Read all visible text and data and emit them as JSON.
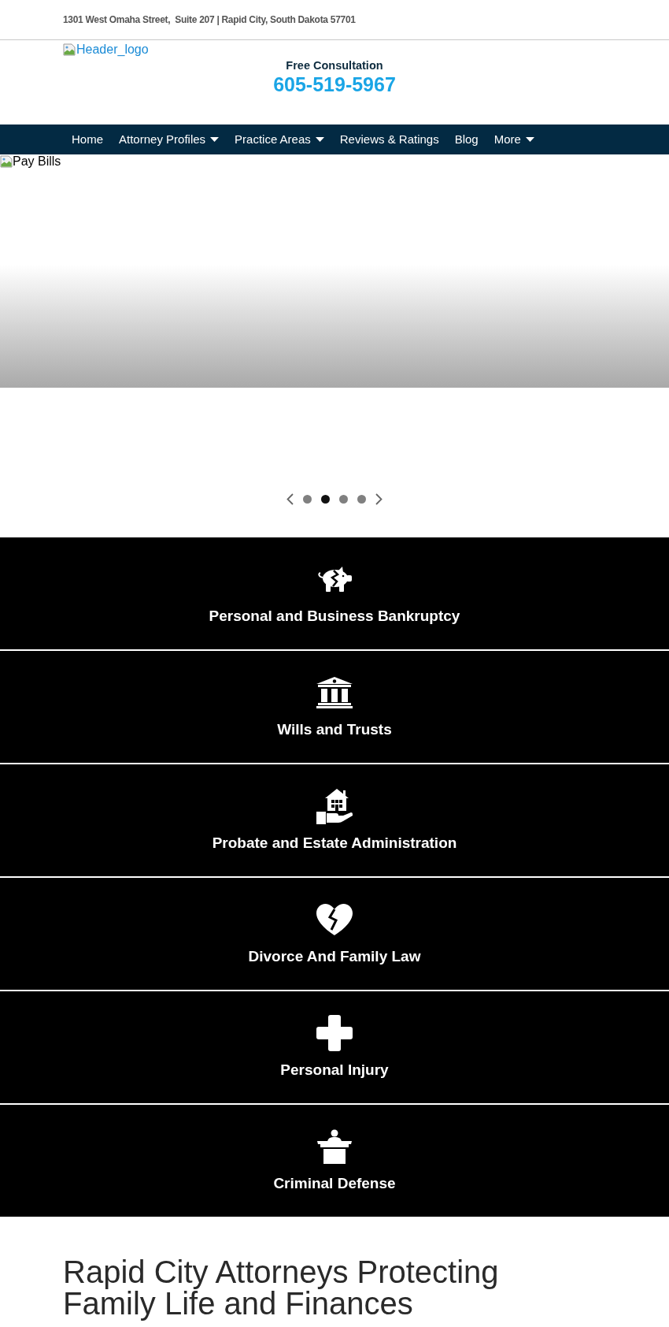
{
  "top_bar": {
    "address": "1301 West Omaha Street,  Suite 207 | Rapid City, South Dakota 57701"
  },
  "header": {
    "logo_alt": "Header_logo",
    "consultation_label": "Free Consultation",
    "phone": "605-519-5967"
  },
  "nav": {
    "items": [
      {
        "label": "Home",
        "dropdown": false
      },
      {
        "label": "Attorney Profiles",
        "dropdown": true
      },
      {
        "label": "Practice Areas",
        "dropdown": true
      },
      {
        "label": "Reviews & Ratings",
        "dropdown": false
      },
      {
        "label": "Blog",
        "dropdown": false
      },
      {
        "label": "More",
        "dropdown": true
      }
    ]
  },
  "hero": {
    "image_alt": "Pay Bills",
    "slides": [
      {
        "selected": false
      },
      {
        "selected": true
      },
      {
        "selected": false
      },
      {
        "selected": false
      }
    ]
  },
  "practice_areas": [
    {
      "title": "Personal and Business Bankruptcy"
    },
    {
      "title": "Wills and Trusts"
    },
    {
      "title": "Probate and Estate Administration"
    },
    {
      "title": "Divorce And Family Law"
    },
    {
      "title": "Personal Injury"
    },
    {
      "title": "Criminal Defense"
    }
  ],
  "intro": {
    "heading": "Rapid City Attorneys Protecting Family Life and Finances"
  }
}
